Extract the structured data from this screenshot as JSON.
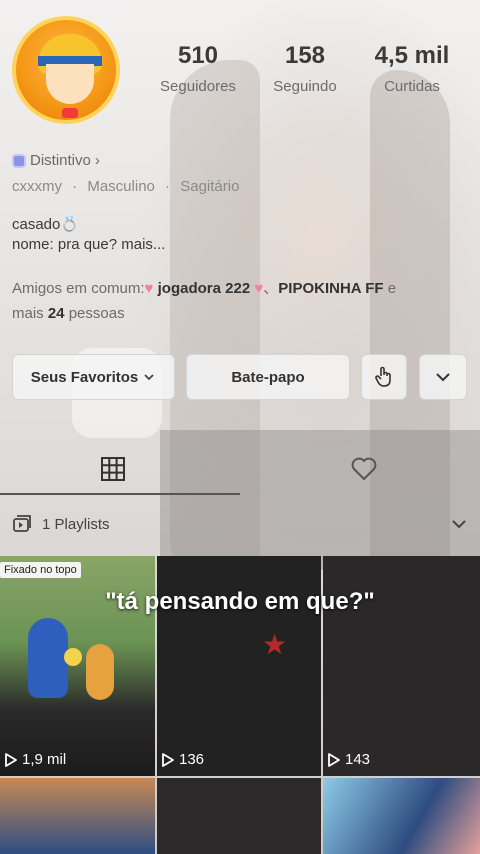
{
  "profile": {
    "stats": [
      {
        "value": "510",
        "label": "Seguidores"
      },
      {
        "value": "158",
        "label": "Seguindo"
      },
      {
        "value": "4,5 mil",
        "label": "Curtidas"
      }
    ],
    "badge_label": "Distintivo",
    "badge_chevron": "›",
    "username": "cxxxmy",
    "gender": "Masculino",
    "sign": "Sagitário",
    "separator": "·",
    "bio_line1": "casado",
    "bio_ring": "💍",
    "bio_line2": "nome: pra que? mais...",
    "friends_prefix": "Amigos em comum:",
    "friend1": "jogadora 222",
    "friend2": "PIPOKINHA FF",
    "friends_sep": "、",
    "friends_and": "e",
    "friends_more_prefix": "mais",
    "friends_more_count": "24",
    "friends_more_suffix": "pessoas",
    "heart_glyph": "♥"
  },
  "actions": {
    "favorites_label": "Seus Favoritos",
    "chat_label": "Bate-papo"
  },
  "tabs": {
    "playlists_label": "1 Playlists"
  },
  "videos": [
    {
      "views": "1,9 mil",
      "pinned": "Fixado no topo"
    },
    {
      "views": "136"
    },
    {
      "views": "143"
    }
  ],
  "caption": "\"tá pensando em que?\"",
  "icons": [
    "grid-icon",
    "heart-outline-icon",
    "playlist-icon",
    "chevron-down-icon",
    "hand-tap-icon",
    "play-icon",
    "distintivo-hex-icon"
  ]
}
